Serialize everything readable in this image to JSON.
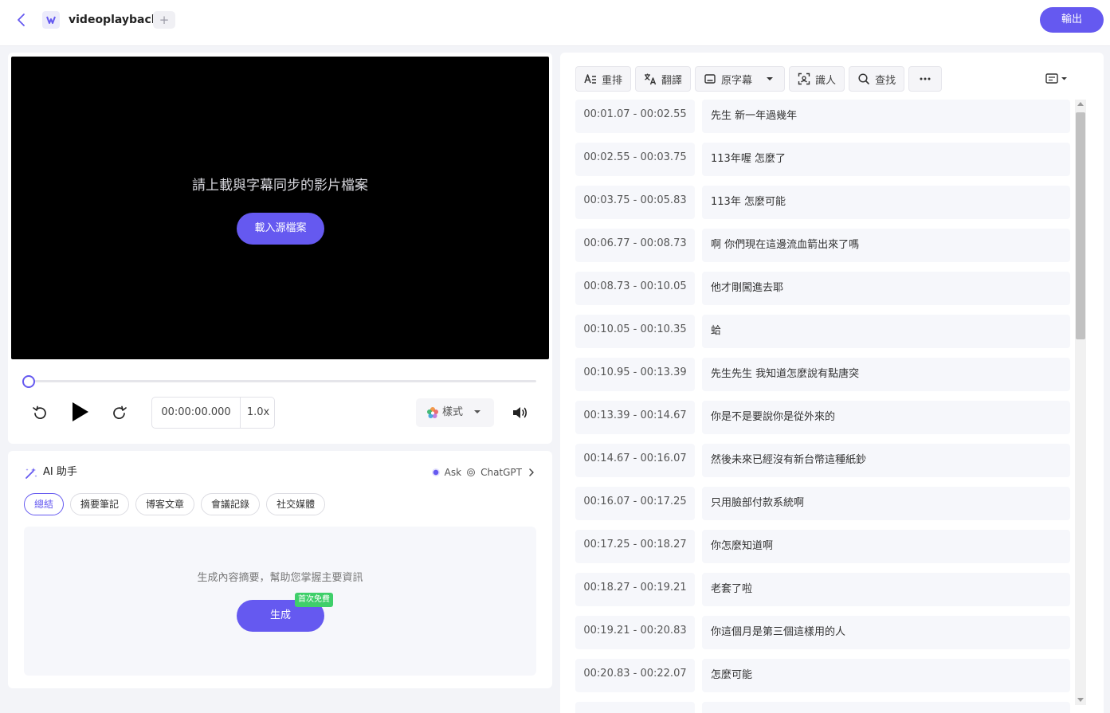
{
  "header": {
    "title": "videoplayback",
    "add_tab": "+",
    "export_label": "輸出"
  },
  "player": {
    "empty_message": "請上載與字幕同步的影片檔案",
    "load_button": "載入源檔案",
    "progress": 0,
    "time": "00:00:00.000",
    "speed": "1.0x",
    "style_label": "樣式"
  },
  "ai": {
    "title": "AI 助手",
    "ask_label": "Ask",
    "gpt_label": "ChatGPT",
    "chips": [
      {
        "label": "總結",
        "active": true
      },
      {
        "label": "摘要筆記"
      },
      {
        "label": "博客文章"
      },
      {
        "label": "會議記錄"
      },
      {
        "label": "社交媒體"
      }
    ],
    "hint": "生成內容摘要，幫助您掌握主要資訊",
    "generate_label": "生成",
    "free_badge": "首次免費"
  },
  "toolbar": {
    "reflow": "重排",
    "translate": "翻譯",
    "subtitle_select": "原字幕",
    "speaker": "識人",
    "find": "查找",
    "more": "···"
  },
  "subtitles": [
    {
      "time": "00:01.07  -  00:02.55",
      "text": "先生 新一年過幾年"
    },
    {
      "time": "00:02.55  -  00:03.75",
      "text": "113年喔 怎麼了"
    },
    {
      "time": "00:03.75  -  00:05.83",
      "text": "113年 怎麼可能"
    },
    {
      "time": "00:06.77  -  00:08.73",
      "text": "啊 你們現在這邊流血箭出來了嗎"
    },
    {
      "time": "00:08.73  -  00:10.05",
      "text": "他才剛闖進去耶"
    },
    {
      "time": "00:10.05  -  00:10.35",
      "text": "蛤"
    },
    {
      "time": "00:10.95  -  00:13.39",
      "text": "先生先生 我知道怎麼說有點唐突"
    },
    {
      "time": "00:13.39  -  00:14.67",
      "text": "你是不是要說你是從外來的"
    },
    {
      "time": "00:14.67  -  00:16.07",
      "text": "然後未來已經沒有新台幣這種紙鈔"
    },
    {
      "time": "00:16.07  -  00:17.25",
      "text": "只用臉部付款系統啊"
    },
    {
      "time": "00:17.25  -  00:18.27",
      "text": "你怎麼知道啊"
    },
    {
      "time": "00:18.27  -  00:19.21",
      "text": "老套了啦"
    },
    {
      "time": "00:19.21  -  00:20.83",
      "text": "你這個月是第三個這樣用的人"
    },
    {
      "time": "00:20.83  -  00:22.07",
      "text": "怎麼可能"
    }
  ],
  "colors": {
    "accent": "#6559f0",
    "badge": "#3fcf6a"
  },
  "icons": [
    "chevron-left-icon",
    "app-logo-icon",
    "rewind-icon",
    "play-icon",
    "forward-icon",
    "flower-icon",
    "caret-down-icon",
    "volume-icon",
    "magic-wand-icon",
    "openai-icon",
    "chevron-right-icon",
    "reflow-icon",
    "translate-icon",
    "subtitle-icon",
    "face-scan-icon",
    "search-icon",
    "more-icon",
    "layout-toggle-icon"
  ]
}
